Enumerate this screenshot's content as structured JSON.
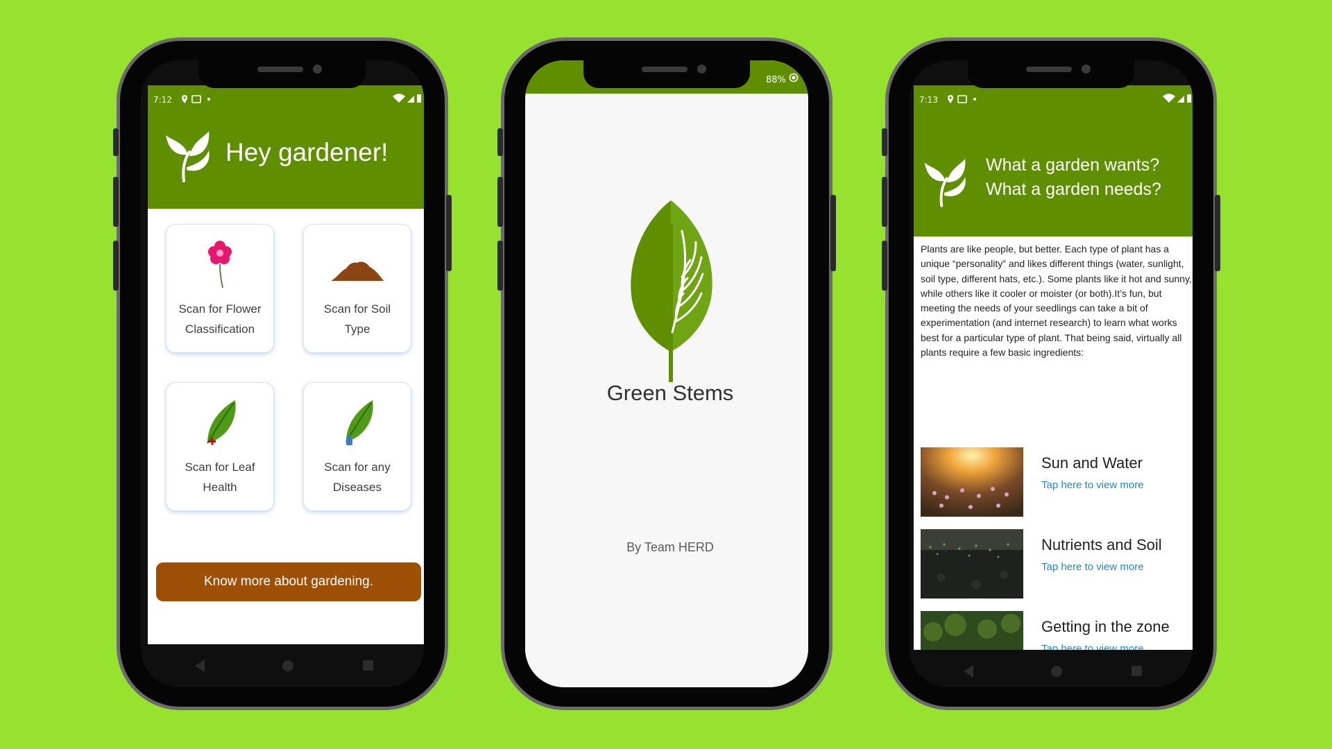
{
  "colors": {
    "background": "#96e22f",
    "header_green": "#5f8f00",
    "cta_brown": "#9d4f03",
    "link_blue": "#1e88c8"
  },
  "phone1": {
    "status": {
      "time": "7:12",
      "battery": "▮"
    },
    "header_title": "Hey gardener!",
    "cards": [
      {
        "label_line1": "Scan for Flower",
        "label_line2": "Classification",
        "icon": "flower-icon"
      },
      {
        "label_line1": "Scan for Soil",
        "label_line2": "Type",
        "icon": "soil-mound-icon"
      },
      {
        "label_line1": "Scan for Leaf",
        "label_line2": "Health",
        "icon": "leaf-health-icon"
      },
      {
        "label_line1": "Scan for any",
        "label_line2": "Diseases",
        "icon": "leaf-disease-icon"
      }
    ],
    "cta_label": "Know more about gardening."
  },
  "phone2": {
    "battery_text": "88%",
    "app_name": "Green Stems",
    "byline": "By Team HERD"
  },
  "phone3": {
    "status": {
      "time": "7:13"
    },
    "title_line1": "What a garden wants?",
    "title_line2": "What a garden needs?",
    "body": "Plants are like people, but better. Each type of plant has a unique “personality” and likes different things (water, sunlight, soil type, different hats, etc.). Some plants like it hot and sunny, while others like it cooler or moister (or both).It’s fun, but meeting the needs of your seedlings can take a bit of experimentation (and internet research) to learn what works best for a particular type of plant. That being said, virtually all plants require a few basic ingredients:",
    "topics": [
      {
        "title": "Sun and Water",
        "link": "Tap here to view more"
      },
      {
        "title": "Nutrients and Soil",
        "link": "Tap here to view more"
      },
      {
        "title": "Getting in the zone",
        "link": "Tap here to view more"
      }
    ]
  }
}
